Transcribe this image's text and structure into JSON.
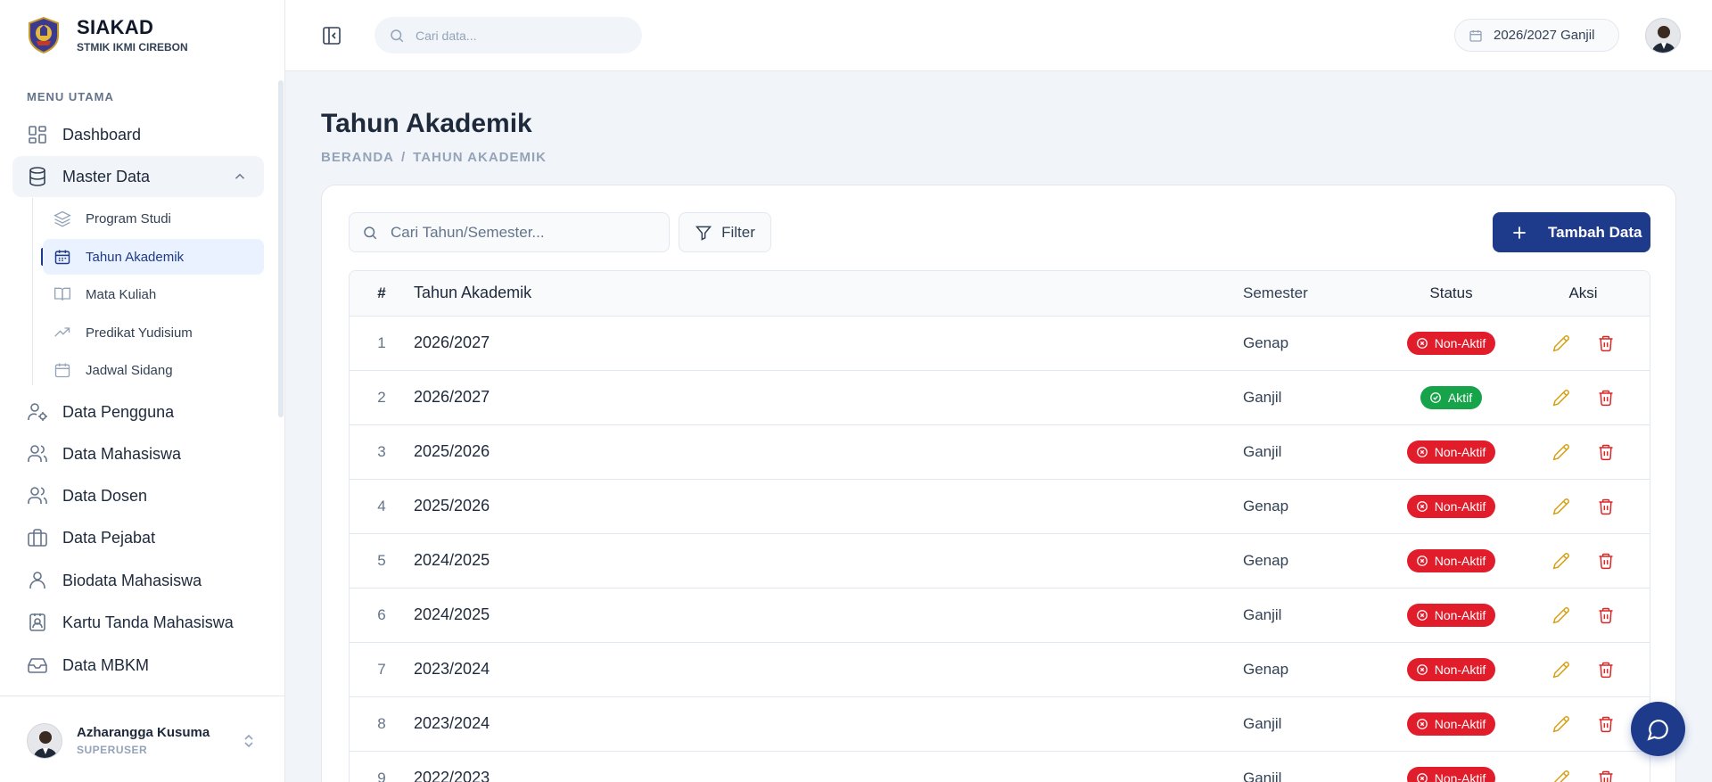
{
  "brand": {
    "title": "SIAKAD",
    "subtitle": "STMIK IKMI CIREBON"
  },
  "sidebar": {
    "heading": "MENU UTAMA",
    "items": [
      {
        "label": "Dashboard",
        "icon": "dashboard-icon"
      },
      {
        "label": "Master Data",
        "icon": "database-icon",
        "expanded": true
      },
      {
        "label": "Data Pengguna",
        "icon": "user-cog-icon"
      },
      {
        "label": "Data Mahasiswa",
        "icon": "users-icon"
      },
      {
        "label": "Data Dosen",
        "icon": "users-icon"
      },
      {
        "label": "Data Pejabat",
        "icon": "briefcase-icon"
      },
      {
        "label": "Biodata Mahasiswa",
        "icon": "user-icon"
      },
      {
        "label": "Kartu Tanda Mahasiswa",
        "icon": "id-card-icon"
      },
      {
        "label": "Data MBKM",
        "icon": "inbox-icon"
      }
    ],
    "subitems": [
      {
        "label": "Program Studi",
        "icon": "layers-icon"
      },
      {
        "label": "Tahun Akademik",
        "icon": "calendar-icon",
        "active": true
      },
      {
        "label": "Mata Kuliah",
        "icon": "book-open-icon"
      },
      {
        "label": "Predikat Yudisium",
        "icon": "trending-up-icon"
      },
      {
        "label": "Jadwal Sidang",
        "icon": "calendar-days-icon"
      }
    ],
    "user": {
      "name": "Azharangga Kusuma",
      "role": "SUPERUSER"
    }
  },
  "topbar": {
    "search_placeholder": "Cari data...",
    "period": "2026/2027 Ganjil"
  },
  "page": {
    "title": "Tahun Akademik",
    "breadcrumb": [
      "BERANDA",
      "/",
      "TAHUN AKADEMIK"
    ]
  },
  "toolbar": {
    "search_placeholder": "Cari Tahun/Semester...",
    "filter_label": "Filter",
    "add_label": "Tambah Data"
  },
  "table": {
    "columns": [
      "#",
      "Tahun Akademik",
      "Semester",
      "Status",
      "Aksi"
    ],
    "rows": [
      {
        "no": "1",
        "year": "2026/2027",
        "semester": "Genap",
        "status": "Non-Aktif"
      },
      {
        "no": "2",
        "year": "2026/2027",
        "semester": "Ganjil",
        "status": "Aktif"
      },
      {
        "no": "3",
        "year": "2025/2026",
        "semester": "Ganjil",
        "status": "Non-Aktif"
      },
      {
        "no": "4",
        "year": "2025/2026",
        "semester": "Genap",
        "status": "Non-Aktif"
      },
      {
        "no": "5",
        "year": "2024/2025",
        "semester": "Genap",
        "status": "Non-Aktif"
      },
      {
        "no": "6",
        "year": "2024/2025",
        "semester": "Ganjil",
        "status": "Non-Aktif"
      },
      {
        "no": "7",
        "year": "2023/2024",
        "semester": "Genap",
        "status": "Non-Aktif"
      },
      {
        "no": "8",
        "year": "2023/2024",
        "semester": "Ganjil",
        "status": "Non-Aktif"
      },
      {
        "no": "9",
        "year": "2022/2023",
        "semester": "Ganjil",
        "status": "Non-Aktif"
      }
    ]
  },
  "colors": {
    "primary": "#1e3a8a",
    "status_active": "#16a34a",
    "status_inactive": "#e11d2b",
    "edit": "#d6a016",
    "delete": "#dc2626"
  }
}
